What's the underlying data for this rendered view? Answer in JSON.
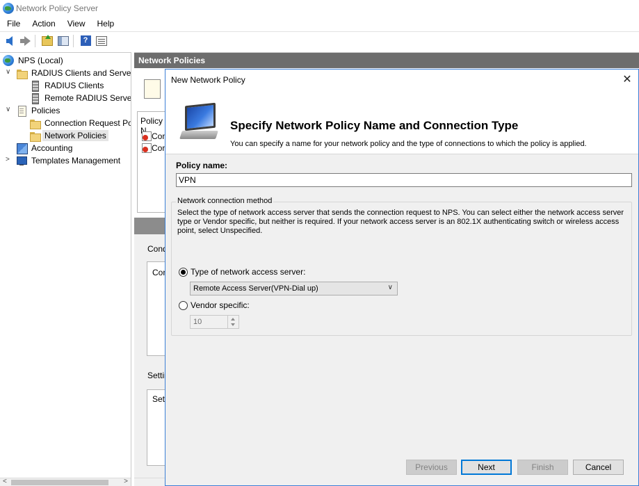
{
  "window": {
    "title": "Network Policy Server"
  },
  "menu": [
    "File",
    "Action",
    "View",
    "Help"
  ],
  "toolbar": {
    "buttons": [
      {
        "icon": "back-arrow-icon"
      },
      {
        "icon": "forward-arrow-icon"
      },
      {
        "icon": "up-one-level-icon"
      },
      {
        "icon": "show-hide-console-tree-icon"
      },
      {
        "icon": "help-icon"
      },
      {
        "icon": "properties-icon"
      }
    ]
  },
  "tree": {
    "items": [
      {
        "label": "NPS (Local)",
        "icon": "globe-icon",
        "expanded": true
      },
      {
        "label": "RADIUS Clients and Servers",
        "icon": "folder-icon",
        "expanded": true
      },
      {
        "label": "RADIUS Clients",
        "icon": "server-icon"
      },
      {
        "label": "Remote RADIUS Server Groups",
        "icon": "server-icon"
      },
      {
        "label": "Policies",
        "icon": "document-icon",
        "expanded": true
      },
      {
        "label": "Connection Request Policies",
        "icon": "folder-icon"
      },
      {
        "label": "Network Policies",
        "icon": "folder-icon",
        "selected": true
      },
      {
        "label": "Accounting",
        "icon": "accounting-icon"
      },
      {
        "label": "Templates Management",
        "icon": "monitor-icon",
        "expanded": false
      }
    ]
  },
  "right_pane": {
    "header": "Network Policies",
    "list_header_fragment": "Policy N",
    "rows_fragment": [
      "Con",
      "Con"
    ],
    "conditions_fragment": "Cond",
    "conditions_box_fragment": "Con",
    "settings_fragment": "Settin",
    "settings_box_fragment": "Sett"
  },
  "dialog": {
    "title": "New Network Policy",
    "heading": "Specify Network Policy Name and Connection Type",
    "subheading": "You can specify a name for your network policy and the type of connections to which the policy is applied.",
    "policy_name_label": "Policy name:",
    "policy_name_value": "VPN",
    "group_legend": "Network connection method",
    "group_description": "Select the type of network access server that sends the connection request to NPS. You can select either the network access server type or Vendor specific, but neither is required.  If your network access server is an 802.1X authenticating switch or wireless access point, select Unspecified.",
    "radio_nas_label": "Type of network access server:",
    "nas_selected": "Remote Access Server(VPN-Dial up)",
    "radio_vendor_label": "Vendor specific:",
    "vendor_value": "10",
    "buttons": {
      "previous": "Previous",
      "next": "Next",
      "finish": "Finish",
      "cancel": "Cancel"
    }
  }
}
